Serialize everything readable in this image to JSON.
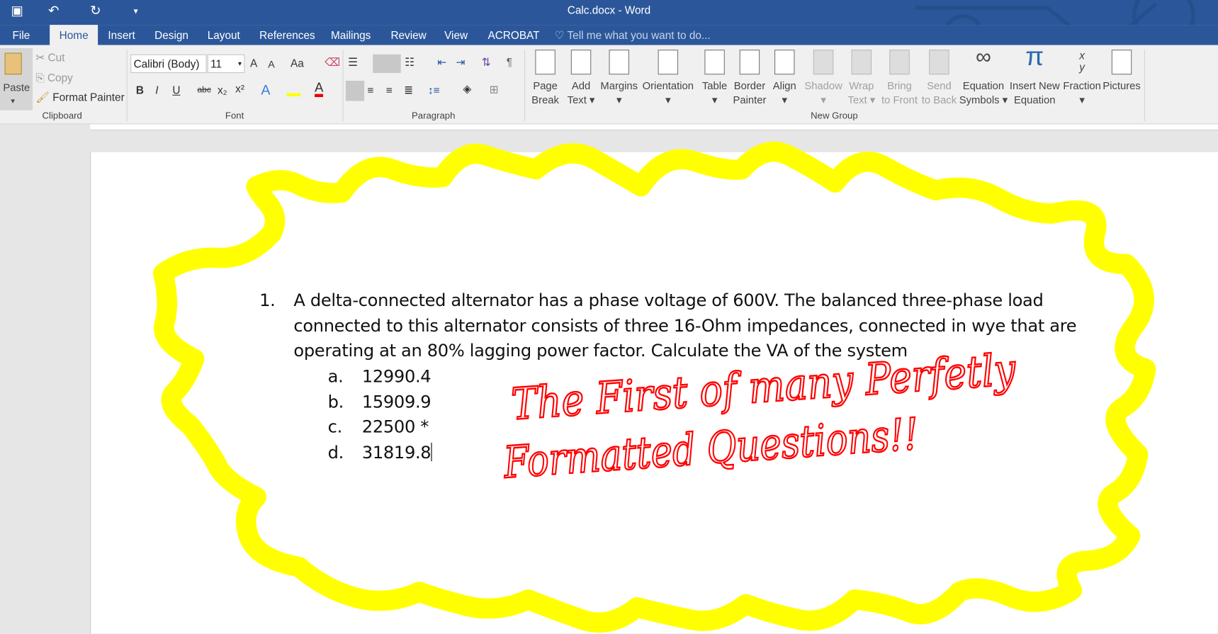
{
  "window": {
    "title": "Calc.docx - Word"
  },
  "qat": {
    "save": "save-icon",
    "undo": "↶",
    "redo": "↻",
    "more": "▾"
  },
  "tabs": [
    "File",
    "Home",
    "Insert",
    "Design",
    "Layout",
    "References",
    "Mailings",
    "Review",
    "View",
    "ACROBAT"
  ],
  "tell_me": "Tell me what you want to do...",
  "clipboard": {
    "paste": "Paste",
    "cut": "Cut",
    "copy": "Copy",
    "format_painter": "Format Painter",
    "label": "Clipboard"
  },
  "font": {
    "name": "Calibri (Body)",
    "size": "11",
    "label": "Font",
    "bold": "B",
    "italic": "I",
    "underline": "U",
    "strike": "abc",
    "sub": "x₂",
    "sup": "x²",
    "case": "Aa",
    "grow": "A",
    "shrink": "A",
    "color": "A"
  },
  "paragraph": {
    "label": "Paragraph"
  },
  "newgroup": {
    "label": "New Group",
    "buttons": [
      {
        "l1": "Page",
        "l2": "Break"
      },
      {
        "l1": "Add",
        "l2": "Text ▾"
      },
      {
        "l1": "Margins",
        "l2": "▾"
      },
      {
        "l1": "Orientation",
        "l2": "▾"
      },
      {
        "l1": "Table",
        "l2": "▾"
      },
      {
        "l1": "Border",
        "l2": "Painter"
      },
      {
        "l1": "Align",
        "l2": "▾"
      },
      {
        "l1": "Shadow",
        "l2": "▾"
      },
      {
        "l1": "Wrap",
        "l2": "Text ▾"
      },
      {
        "l1": "Bring",
        "l2": "to Front"
      },
      {
        "l1": "Send",
        "l2": "to Back"
      },
      {
        "l1": "Equation",
        "l2": "Symbols ▾"
      },
      {
        "l1": "Insert New",
        "l2": "Equation"
      },
      {
        "l1": "Fraction",
        "l2": "▾"
      },
      {
        "l1": "Pictures",
        "l2": ""
      }
    ]
  },
  "document": {
    "number": "1.",
    "question_lines": [
      "A delta-connected alternator has a phase voltage of 600V.  The balanced three-phase load",
      "connected to this alternator consists of three 16-Ohm impedances, connected in wye that are",
      "operating at an 80% lagging power factor.  Calculate the VA of the system"
    ],
    "options": [
      {
        "letter": "a.",
        "value": "12990.4"
      },
      {
        "letter": "b.",
        "value": "15909.9"
      },
      {
        "letter": "c.",
        "value": "22500 *"
      },
      {
        "letter": "d.",
        "value": "31819.8"
      }
    ]
  },
  "annotation": {
    "line1": "The First of many Perfetly",
    "line2": "Formatted Questions!!",
    "ink_color": "#ff0000",
    "highlight_color": "#ffff00"
  }
}
